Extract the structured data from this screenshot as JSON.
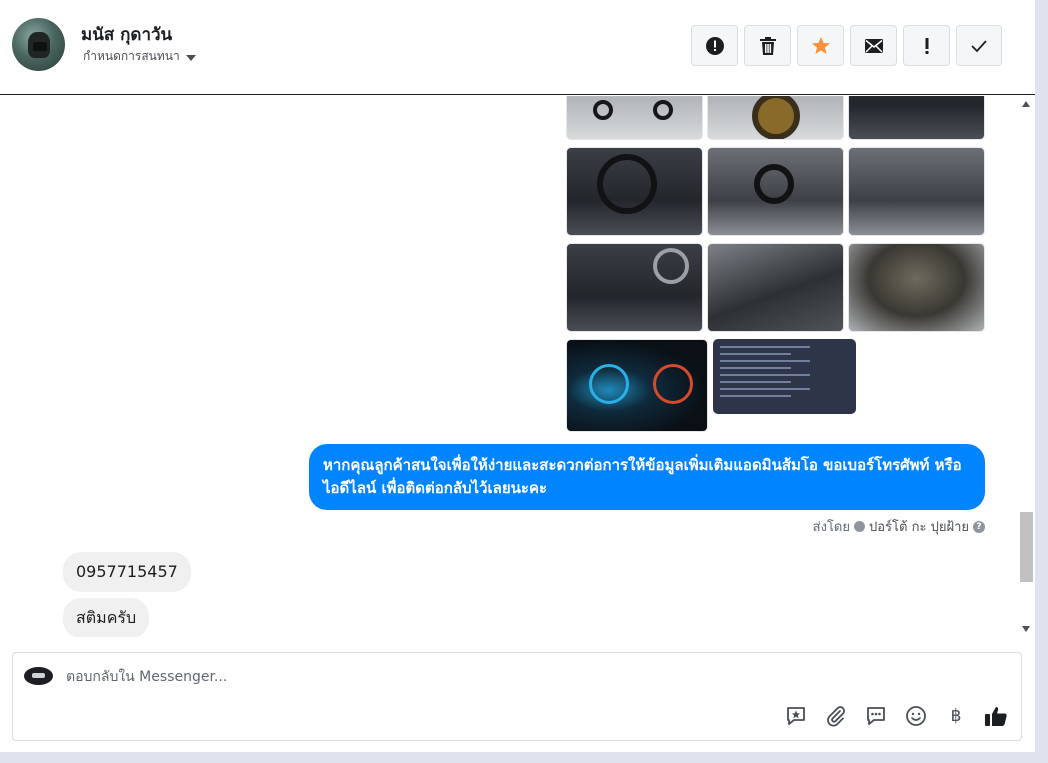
{
  "header": {
    "contact_name": "มนัส กุดาวัน",
    "assign_label": "กำหนดการสนทนา",
    "toolbar": [
      {
        "name": "spam-button",
        "icon": "exclamation-circle-icon"
      },
      {
        "name": "delete-button",
        "icon": "trash-icon"
      },
      {
        "name": "star-button",
        "icon": "star-icon",
        "color": "#f7923b"
      },
      {
        "name": "mark-unread-button",
        "icon": "envelope-icon"
      },
      {
        "name": "follow-up-button",
        "icon": "exclamation-icon"
      },
      {
        "name": "mark-done-button",
        "icon": "checkmark-icon"
      }
    ]
  },
  "conversation": {
    "outgoing_message": "หากคุณลูกค้าสนใจเพื่อให้ง่ายและสะดวกต่อการให้ข้อมูลเพิ่มเติมแอดมินส้มโอ ขอเบอร์โทรศัพท์ หรือ ไอดีไลน์ เพื่อติดต่อกลับไว้เลยนะคะ",
    "sent_by_label": "ส่งโดย",
    "sent_by_agent": "ปอร์โต้ กะ ปุยฝ้าย",
    "incoming_messages": [
      "0957715457",
      "สติมครับ"
    ]
  },
  "composer": {
    "placeholder": "ตอบกลับใน Messenger...",
    "tools": [
      "saved-reply-icon",
      "attachment-icon",
      "comment-icon",
      "emoji-icon",
      "baht-icon",
      "thumbs-up-icon"
    ],
    "baht_glyph": "฿"
  },
  "colors": {
    "accent": "#0084ff",
    "star": "#f7923b"
  }
}
